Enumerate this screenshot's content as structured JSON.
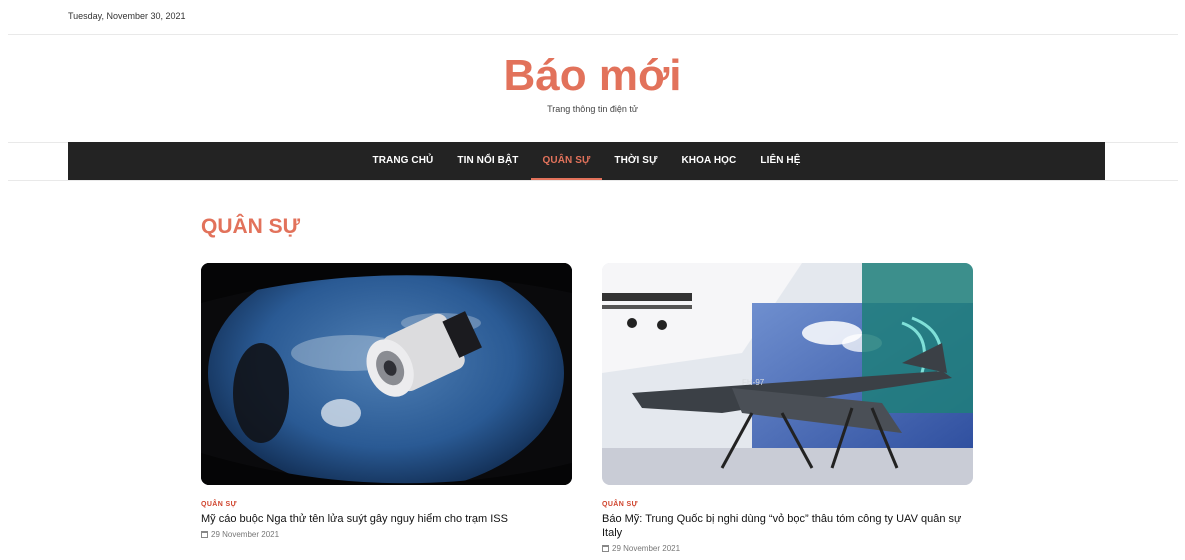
{
  "topbar": {
    "date": "Tuesday, November 30, 2021"
  },
  "brand": {
    "title": "Báo mới",
    "tagline": "Trang thông tin điện tử"
  },
  "nav": {
    "items": [
      {
        "label": "TRANG CHỦ",
        "active": false
      },
      {
        "label": "TIN NỔI BẬT",
        "active": false
      },
      {
        "label": "QUÂN SỰ",
        "active": true
      },
      {
        "label": "THỜI SỰ",
        "active": false
      },
      {
        "label": "KHOA HỌC",
        "active": false
      },
      {
        "label": "LIÊN HỆ",
        "active": false
      }
    ]
  },
  "section": {
    "title": "QUÂN SỰ"
  },
  "articles": [
    {
      "category": "QUÂN SỰ",
      "title": "Mỹ cáo buộc Nga thử tên lửa suýt gây nguy hiểm cho trạm ISS",
      "date": "29 November 2021",
      "image": "spacecraft-in-orbit"
    },
    {
      "category": "QUÂN SỰ",
      "title": "Báo Mỹ: Trung Quốc bị nghi dùng “vỏ bọc” thâu tóm công ty UAV quân sự Italy",
      "date": "29 November 2021",
      "image": "uav-exhibition",
      "image_text": "FH-97"
    }
  ],
  "colors": {
    "accent": "#e2725b",
    "nav_bg": "#232323",
    "category": "#d0432c"
  }
}
